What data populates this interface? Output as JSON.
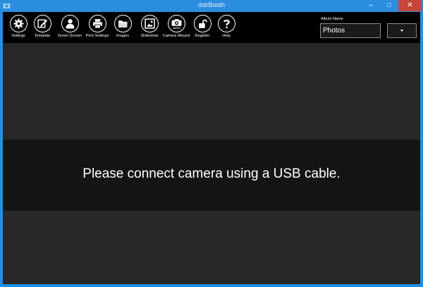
{
  "window": {
    "title": "dslrBooth",
    "controls": {
      "minimize": "–",
      "maximize": "□",
      "close": "✕"
    }
  },
  "toolbar": {
    "items": [
      {
        "label": "Settings",
        "icon": "gear-icon"
      },
      {
        "label": "Template",
        "icon": "template-edit-icon"
      },
      {
        "label": "Green Screen",
        "icon": "person-icon"
      },
      {
        "label": "Print Settings",
        "icon": "printer-icon"
      },
      {
        "label": "Images",
        "icon": "folder-icon"
      },
      {
        "label": "Slideshow",
        "icon": "slideshow-icon"
      },
      {
        "label": "Camera Wizard",
        "icon": "camera-auto-icon"
      },
      {
        "label": "Register",
        "icon": "unlock-icon"
      },
      {
        "label": "Help",
        "icon": "question-icon"
      }
    ]
  },
  "album": {
    "label": "Album Name",
    "value": "Photos"
  },
  "main": {
    "message": "Please connect camera using a USB cable."
  },
  "colors": {
    "titlebar": "#2a8de0",
    "toolbar": "#000000",
    "background": "#282828",
    "message_band": "#141414",
    "close_button": "#c7463a"
  }
}
